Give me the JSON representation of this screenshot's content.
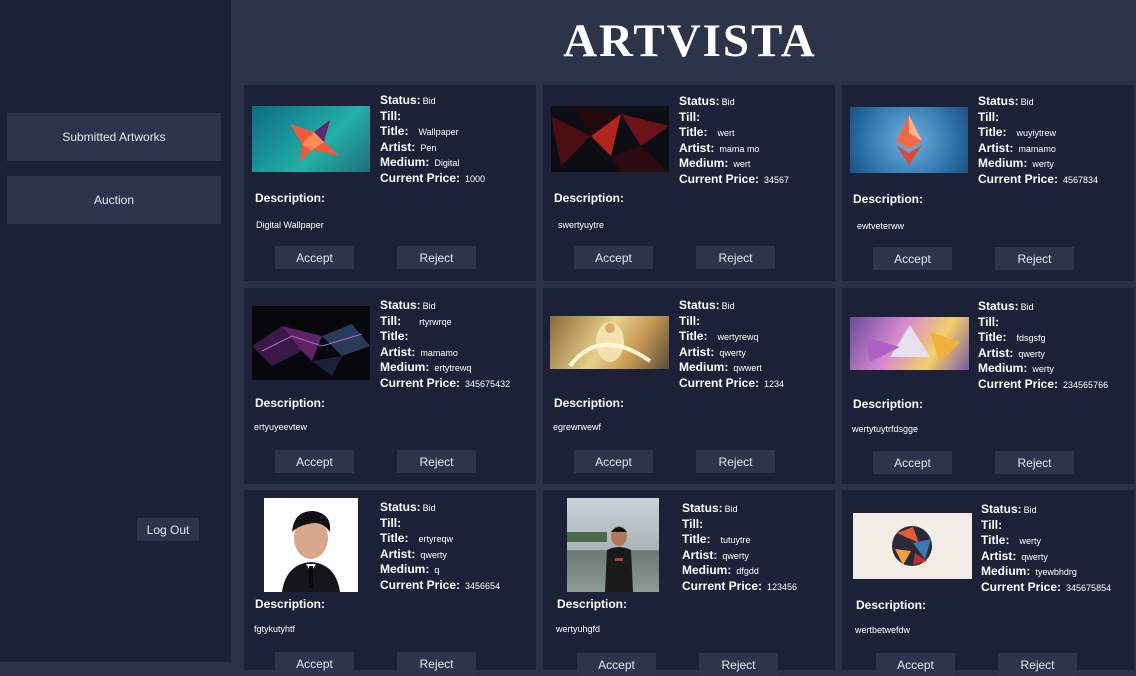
{
  "app": {
    "title": "ARTVISTA"
  },
  "sidebar": {
    "submitted_label": "Submitted Artworks",
    "auction_label": "Auction",
    "logout_label": "Log Out"
  },
  "labels": {
    "status": "Status:",
    "till": "Till:",
    "title": "Title:",
    "artist": "Artist:",
    "medium": "Medium:",
    "price": "Current Price:",
    "description": "Description:",
    "accept": "Accept",
    "reject": "Reject"
  },
  "cards": [
    {
      "status": "Bid",
      "till": "",
      "title": "Wallpaper",
      "artist": "Pen",
      "medium": "Digital",
      "price": "1000",
      "description": "Digital Wallpaper"
    },
    {
      "status": "Bid",
      "till": "",
      "title": "wert",
      "artist": "mama mo",
      "medium": "wert",
      "price": "34567",
      "description": "swertyuytre"
    },
    {
      "status": "Bid",
      "till": "",
      "title": "wuyiytrew",
      "artist": "mamamo",
      "medium": "werty",
      "price": "4567834",
      "description": "ewtveterww"
    },
    {
      "status": "Bid",
      "till": "rtyrwrqe",
      "title": "",
      "artist": "mamamo",
      "medium": "ertytrewq",
      "price": "345675432",
      "description": "ertyuyeevtew"
    },
    {
      "status": "Bid",
      "till": "",
      "title": "wertyrewq",
      "artist": "qwerty",
      "medium": "qwwert",
      "price": "1234",
      "description": "egrewrwewf"
    },
    {
      "status": "Bid",
      "till": "",
      "title": "fdsgsfg",
      "artist": "qwerty",
      "medium": "werty",
      "price": "234565766",
      "description": "wertytuytrfdsgge"
    },
    {
      "status": "Bid",
      "till": "",
      "title": "ertyreqw",
      "artist": "qwerty",
      "medium": "q",
      "price": "3456654",
      "description": "fgtykutyhtf"
    },
    {
      "status": "Bid",
      "till": "",
      "title": "tutuytre",
      "artist": "qwerty",
      "medium": "dfgdd",
      "price": "123456",
      "description": "wertyuhgfd"
    },
    {
      "status": "Bid",
      "till": "",
      "title": "werty",
      "artist": "qwerty",
      "medium": "tyewbhdrg",
      "price": "345675854",
      "description": "wertbetwefdw"
    }
  ]
}
